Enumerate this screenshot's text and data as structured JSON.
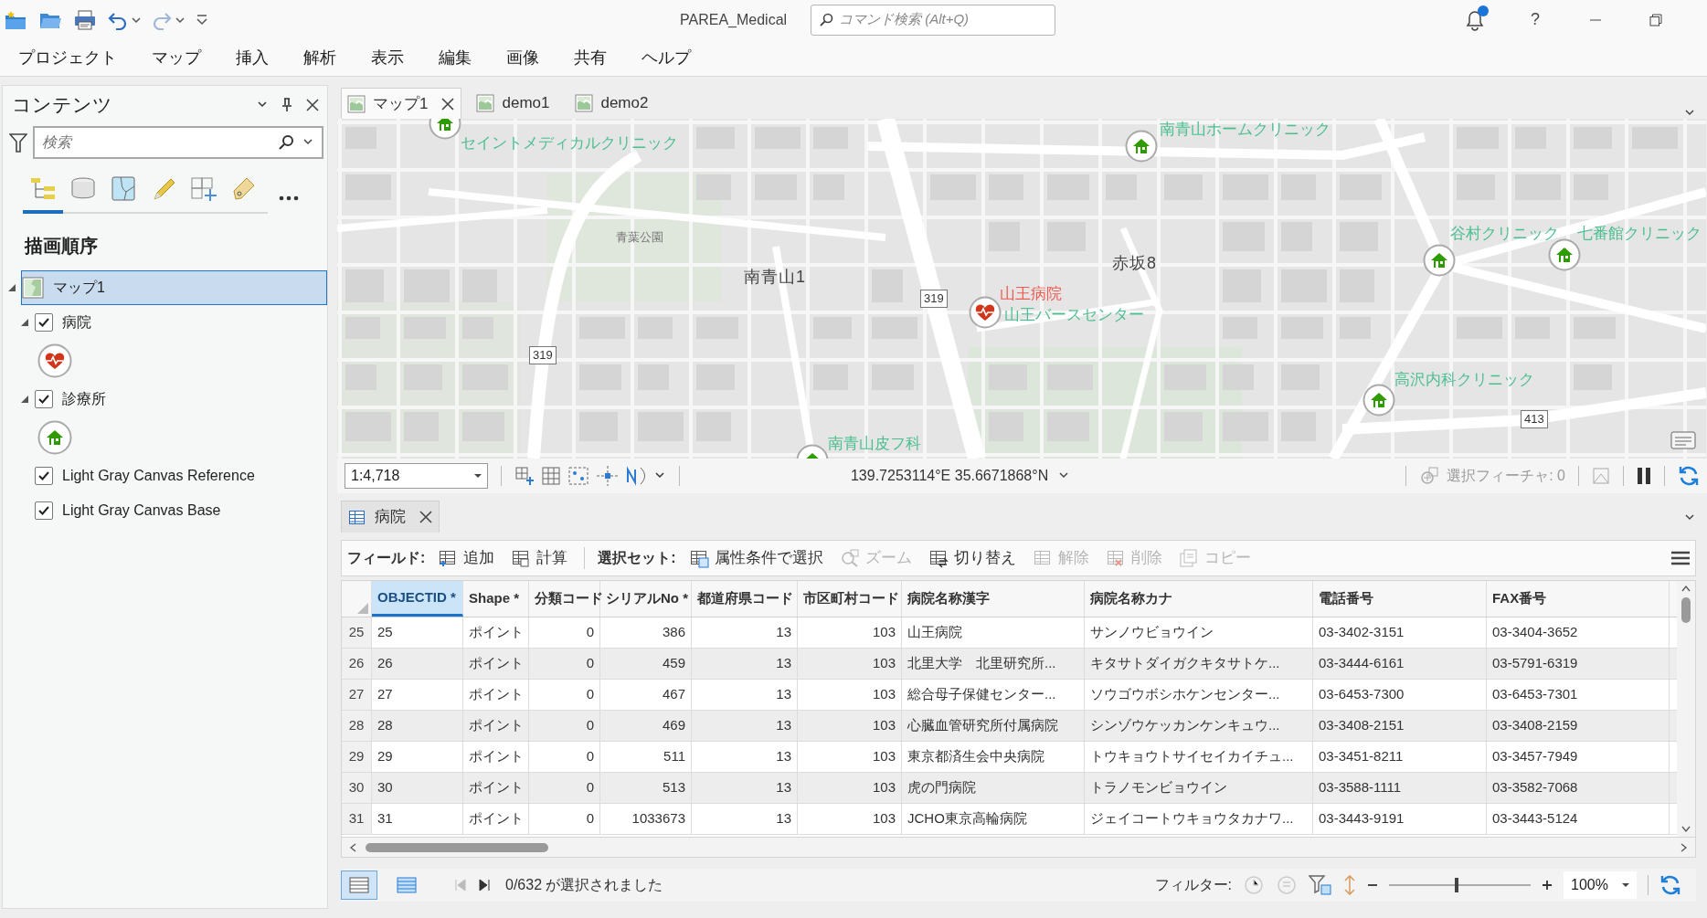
{
  "window": {
    "title": "PAREA_Medical",
    "command_search": {
      "placeholder": "コマンド検索 (Alt+Q)"
    },
    "has_notifications": true,
    "help": "?"
  },
  "menu": [
    "プロジェクト",
    "マップ",
    "挿入",
    "解析",
    "表示",
    "編集",
    "画像",
    "共有",
    "ヘルプ"
  ],
  "contents_pane": {
    "title": "コンテンツ",
    "search": {
      "placeholder": "検索"
    },
    "view_tabs": [
      {
        "kind": "drawing-order",
        "selected": true
      },
      {
        "kind": "data-source",
        "selected": false
      },
      {
        "kind": "selection",
        "selected": false
      },
      {
        "kind": "editing",
        "selected": false
      },
      {
        "kind": "snapping",
        "selected": false
      },
      {
        "kind": "labeling",
        "selected": false
      }
    ],
    "heading": "描画順序",
    "layers": [
      {
        "label": "マップ1",
        "kind": "map",
        "selected": true,
        "expanded": true,
        "children": [
          {
            "label": "病院",
            "kind": "layer",
            "checked": true,
            "expanded": true,
            "symbol": {
              "kind": "hospital"
            }
          },
          {
            "label": "診療所",
            "kind": "layer",
            "checked": true,
            "expanded": true,
            "symbol": {
              "kind": "clinic"
            }
          },
          {
            "label": "Light Gray Canvas Reference",
            "kind": "layer",
            "checked": true
          },
          {
            "label": "Light Gray Canvas Base",
            "kind": "layer",
            "checked": true
          }
        ]
      }
    ]
  },
  "map_tabs": [
    {
      "label": "マップ1",
      "selected": true
    },
    {
      "label": "demo1",
      "selected": false
    },
    {
      "label": "demo2",
      "selected": false
    }
  ],
  "map": {
    "features": [
      {
        "kind": "clinic",
        "label": "セイントメディカルクリニック"
      },
      {
        "kind": "clinic",
        "label": "南青山ホームクリニック"
      },
      {
        "kind": "hospital",
        "label": "山王病院"
      },
      {
        "kind": "clinic",
        "label": "山王バースセンター"
      },
      {
        "kind": "clinic",
        "label": "谷村クリニック"
      },
      {
        "kind": "clinic",
        "label": "七番館クリニック"
      },
      {
        "kind": "clinic",
        "label": "高沢内科クリニック"
      },
      {
        "kind": "clinic",
        "label": "南青山皮フ科"
      }
    ],
    "place_labels": [
      {
        "kind": "park",
        "text": "青葉公園"
      },
      {
        "kind": "area",
        "text": "南青山1"
      },
      {
        "kind": "area",
        "text": "赤坂8"
      }
    ],
    "route_shields": [
      "319",
      "319",
      "413"
    ]
  },
  "map_status": {
    "scale": "1:4,718",
    "coordinates": "139.7253114°E 35.6671868°N",
    "selected_features": "選択フィーチャ: 0"
  },
  "table_tab": {
    "label": "病院"
  },
  "table_toolbar": {
    "field_label": "フィールド:",
    "field_buttons": [
      {
        "kind": "add",
        "label": "追加",
        "disabled": false
      },
      {
        "kind": "calculate",
        "label": "計算",
        "disabled": false
      }
    ],
    "selection_label": "選択セット:",
    "selection_buttons": [
      {
        "kind": "select-by-attributes",
        "label": "属性条件で選択",
        "disabled": false
      },
      {
        "kind": "zoom",
        "label": "ズーム",
        "disabled": true
      },
      {
        "kind": "switch",
        "label": "切り替え",
        "disabled": false
      },
      {
        "kind": "clear",
        "label": "解除",
        "disabled": true
      },
      {
        "kind": "delete",
        "label": "削除",
        "disabled": true
      },
      {
        "kind": "copy",
        "label": "コピー",
        "disabled": true
      }
    ]
  },
  "table": {
    "columns": [
      {
        "label": "OBJECTID *",
        "kind": "text",
        "selected": true
      },
      {
        "label": "Shape *",
        "kind": "text",
        "selected": false
      },
      {
        "label": "分類コード",
        "kind": "number",
        "selected": false
      },
      {
        "label": "シリアルNo *",
        "kind": "number",
        "selected": false
      },
      {
        "label": "都道府県コード",
        "kind": "number",
        "selected": false
      },
      {
        "label": "市区町村コード",
        "kind": "number",
        "selected": false
      },
      {
        "label": "病院名称漢字",
        "kind": "text",
        "selected": false
      },
      {
        "label": "病院名称カナ",
        "kind": "text",
        "selected": false
      },
      {
        "label": "電話番号",
        "kind": "text",
        "selected": false
      },
      {
        "label": "FAX番号",
        "kind": "text",
        "selected": false
      }
    ],
    "rows": [
      {
        "row_number": "25",
        "cells": [
          "25",
          "ポイント",
          "0",
          "386",
          "13",
          "103",
          "山王病院",
          "サンノウビョウイン",
          "03-3402-3151",
          "03-3404-3652"
        ]
      },
      {
        "row_number": "26",
        "cells": [
          "26",
          "ポイント",
          "0",
          "459",
          "13",
          "103",
          "北里大学　北里研究所...",
          "キタサトダイガクキタサトケ...",
          "03-3444-6161",
          "03-5791-6319"
        ]
      },
      {
        "row_number": "27",
        "cells": [
          "27",
          "ポイント",
          "0",
          "467",
          "13",
          "103",
          "総合母子保健センター...",
          "ソウゴウボシホケンセンター...",
          "03-6453-7300",
          "03-6453-7301"
        ]
      },
      {
        "row_number": "28",
        "cells": [
          "28",
          "ポイント",
          "0",
          "469",
          "13",
          "103",
          "心臓血管研究所付属病院",
          "シンゾウケッカンケンキュウ...",
          "03-3408-2151",
          "03-3408-2159"
        ]
      },
      {
        "row_number": "29",
        "cells": [
          "29",
          "ポイント",
          "0",
          "511",
          "13",
          "103",
          "東京都済生会中央病院",
          "トウキョウトサイセイカイチュ...",
          "03-3451-8211",
          "03-3457-7949"
        ]
      },
      {
        "row_number": "30",
        "cells": [
          "30",
          "ポイント",
          "0",
          "513",
          "13",
          "103",
          "虎の門病院",
          "トラノモンビョウイン",
          "03-3588-1111",
          "03-3582-7068"
        ]
      },
      {
        "row_number": "31",
        "cells": [
          "31",
          "ポイント",
          "0",
          "1033673",
          "13",
          "103",
          "JCHO東京高輪病院",
          "ジェイコートウキョウタカナワ...",
          "03-3443-9191",
          "03-3443-5124"
        ]
      }
    ]
  },
  "table_footer": {
    "view_buttons": [
      {
        "kind": "all-records",
        "selected": true
      },
      {
        "kind": "selected-records",
        "selected": false
      }
    ],
    "selection_text": "0/632 が選択されました",
    "filter_label": "フィルター:",
    "zoom": {
      "level": 0.48,
      "reading": "100%"
    }
  }
}
